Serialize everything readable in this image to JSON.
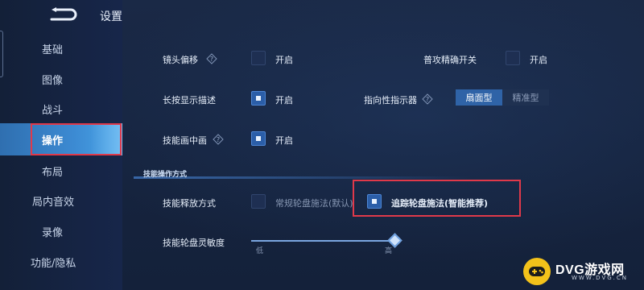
{
  "header": {
    "title": "设置",
    "back_icon": "back-arrow-icon"
  },
  "sidebar": {
    "items": [
      {
        "label": "基础"
      },
      {
        "label": "图像"
      },
      {
        "label": "战斗"
      },
      {
        "label": "操作",
        "active": true
      },
      {
        "label": "布局"
      },
      {
        "label": "局内音效"
      },
      {
        "label": "录像"
      },
      {
        "label": "功能/隐私"
      }
    ]
  },
  "settings": {
    "camera_offset": {
      "label": "镜头偏移",
      "state": "开启",
      "checked": false
    },
    "precise_attack": {
      "label": "普攻精确开关",
      "state": "开启",
      "checked": false
    },
    "long_press_desc": {
      "label": "长按显示描述",
      "state": "开启",
      "checked": true
    },
    "direction_indicator": {
      "label": "指向性指示器",
      "options": [
        "扇面型",
        "精准型"
      ],
      "selected": "扇面型"
    },
    "skill_pip": {
      "label": "技能画中画",
      "state": "开启",
      "checked": true
    }
  },
  "skill_section": {
    "title": "技能操作方式",
    "release_mode": {
      "label": "技能释放方式",
      "option1": "常规轮盘施法(默认)",
      "option2": "追踪轮盘施法(智能推荐)",
      "selected": "option2"
    },
    "sensitivity": {
      "label": "技能轮盘灵敏度",
      "low": "低",
      "high": "高",
      "value_fraction": 1.0
    }
  },
  "watermark": {
    "text": "DVG游戏网",
    "sub": "WWW.DVG.CN"
  },
  "colors": {
    "accent": "#2f63a7",
    "highlight_box": "#e0394a",
    "watermark_badge": "#f3c21a"
  }
}
